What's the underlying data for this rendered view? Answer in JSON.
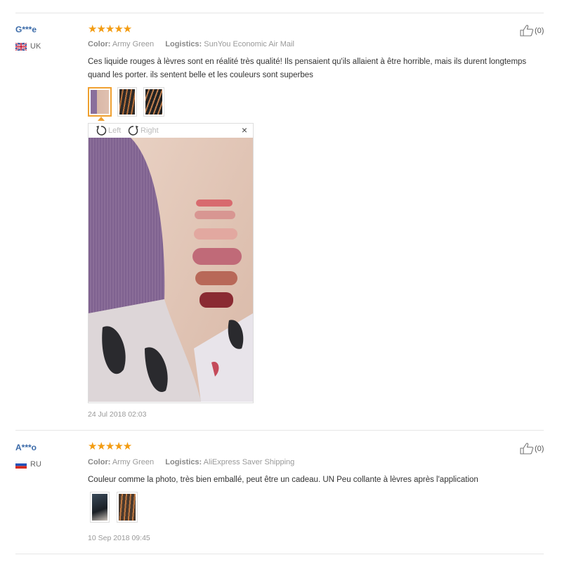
{
  "reviews": [
    {
      "user": "G***e",
      "country": "UK",
      "flag_icon": "uk-flag-icon",
      "rating": "★★★★★",
      "color_label": "Color:",
      "color_value": "Army Green",
      "logistics_label": "Logistics:",
      "logistics_value": "SunYou Economic Air Mail",
      "text": "Ces liquide rouges à lèvres sont en réalité très qualité! Ils pensaient qu'ils allaient à être horrible, mais ils durent longtemps quand les porter. ils sentent belle et les couleurs sont superbes",
      "helpful": "(0)",
      "viewer": {
        "left": "Left",
        "right": "Right",
        "close": "×"
      },
      "date": "24 Jul 2018 02:03"
    },
    {
      "user": "A***o",
      "country": "RU",
      "flag_icon": "ru-flag-icon",
      "rating": "★★★★★",
      "color_label": "Color:",
      "color_value": "Army Green",
      "logistics_label": "Logistics:",
      "logistics_value": "AliExpress Saver Shipping",
      "text": "Couleur comme la photo, très bien emballé, peut être un cadeau. UN Peu collante à lèvres après l'application",
      "helpful": "(0)",
      "date": "10 Sep 2018 09:45"
    }
  ]
}
